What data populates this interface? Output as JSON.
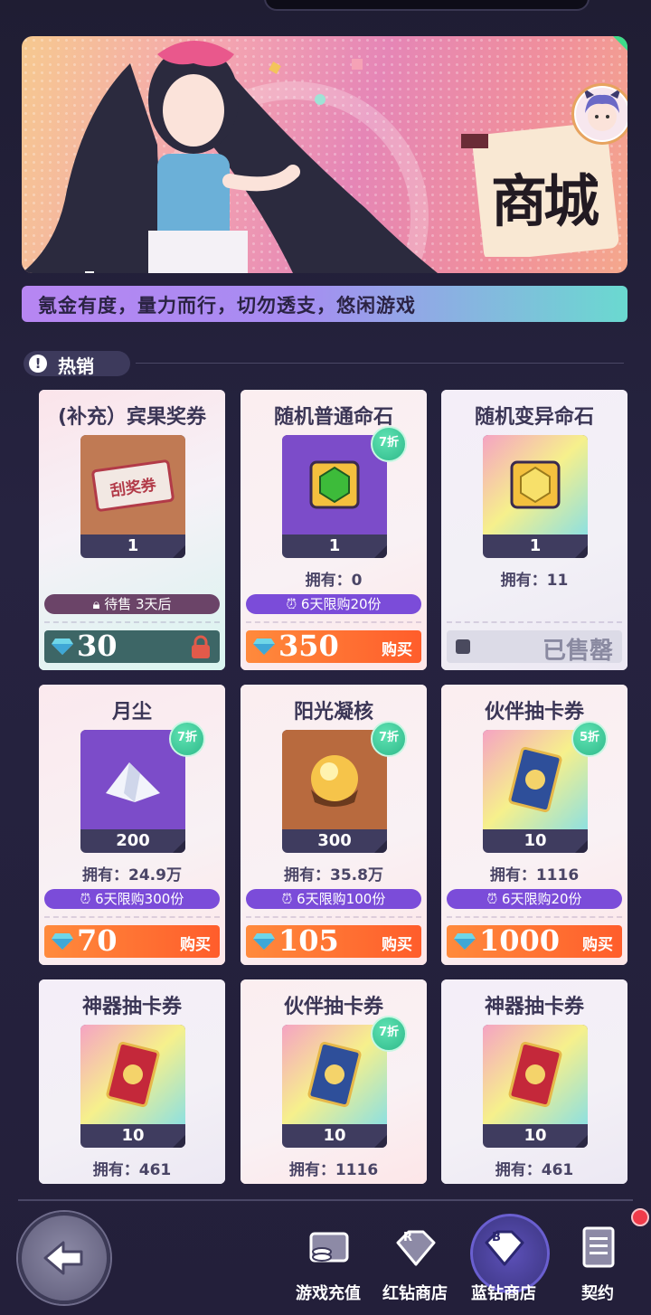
{
  "banner": {
    "title": "商城"
  },
  "notice": "氪金有度，量力而行，切勿透支，悠闲游戏",
  "section": {
    "label": "热销",
    "icon": "alert-icon"
  },
  "items": [
    {
      "name": "(补充）宾果奖券",
      "qty": "1",
      "art_text": "刮奖券",
      "status": "待售 3天后",
      "price": "30",
      "state": "locked"
    },
    {
      "name": "随机普通命石",
      "qty": "1",
      "discount": "7折",
      "owned": "拥有：0",
      "limit": "6天限购20份",
      "price": "350",
      "buy": "购买"
    },
    {
      "name": "随机变异命石",
      "qty": "1",
      "owned": "拥有：11",
      "sold": "已售罄"
    },
    {
      "name": "月尘",
      "qty": "200",
      "discount": "7折",
      "owned": "拥有：24.9万",
      "limit": "6天限购300份",
      "price": "70",
      "buy": "购买"
    },
    {
      "name": "阳光凝核",
      "qty": "300",
      "discount": "7折",
      "owned": "拥有：35.8万",
      "limit": "6天限购100份",
      "price": "105",
      "buy": "购买"
    },
    {
      "name": "伙伴抽卡券",
      "qty": "10",
      "discount": "5折",
      "owned": "拥有：1116",
      "limit": "6天限购20份",
      "price": "1000",
      "buy": "购买"
    },
    {
      "name": "神器抽卡券",
      "qty": "10",
      "owned": "拥有：461"
    },
    {
      "name": "伙伴抽卡券",
      "qty": "10",
      "discount": "7折",
      "owned": "拥有：1116"
    },
    {
      "name": "神器抽卡券",
      "qty": "10",
      "owned": "拥有：461"
    }
  ],
  "nav": [
    {
      "label": "游戏充值",
      "icon": "wallet-icon"
    },
    {
      "label": "红钻商店",
      "icon": "red-diamond-icon"
    },
    {
      "label": "蓝钻商店",
      "icon": "blue-diamond-icon",
      "active": true
    },
    {
      "label": "契约",
      "icon": "contract-icon"
    }
  ],
  "colors": {
    "price": "#ff6a30",
    "limit": "#7b4cd9",
    "badge": "#3cc796",
    "bg": "#242038"
  }
}
